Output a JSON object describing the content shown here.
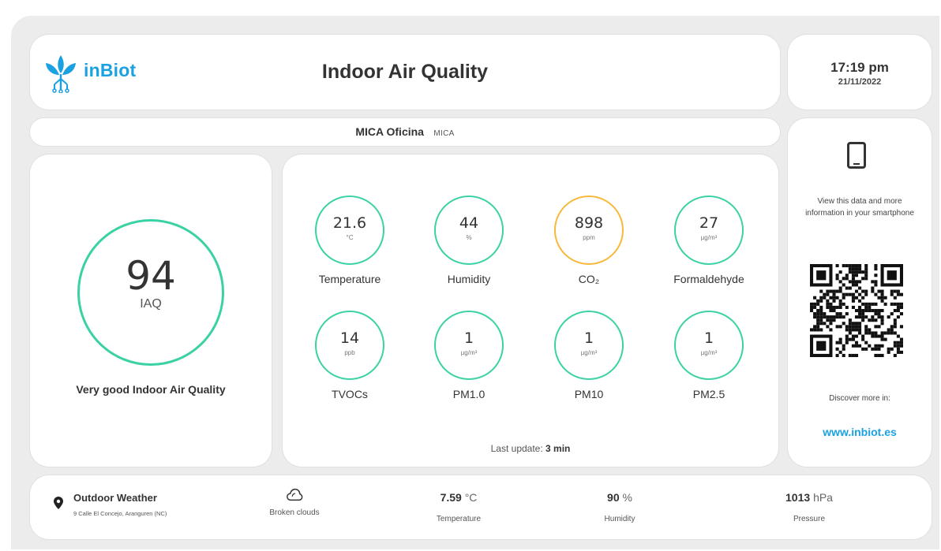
{
  "header": {
    "brand": "inBiot",
    "title": "Indoor Air Quality"
  },
  "clock": {
    "time": "17:19 pm",
    "date": "21/11/2022"
  },
  "location": {
    "name": "MICA Oficina",
    "code": "MICA"
  },
  "iaq": {
    "value": "94",
    "label": "IAQ",
    "status": "Very good Indoor Air Quality",
    "ring_color": "#3ad2a4"
  },
  "metrics": [
    {
      "value": "21.6",
      "unit": "°C",
      "name": "Temperature",
      "state": "good"
    },
    {
      "value": "44",
      "unit": "%",
      "name": "Humidity",
      "state": "good"
    },
    {
      "value": "898",
      "unit": "ppm",
      "name": "CO₂",
      "state": "warning"
    },
    {
      "value": "27",
      "unit": "µg/m³",
      "name": "Formaldehyde",
      "state": "good"
    },
    {
      "value": "14",
      "unit": "ppb",
      "name": "TVOCs",
      "state": "good"
    },
    {
      "value": "1",
      "unit": "µg/m³",
      "name": "PM1.0",
      "state": "good"
    },
    {
      "value": "1",
      "unit": "µg/m³",
      "name": "PM10",
      "state": "good"
    },
    {
      "value": "1",
      "unit": "µg/m³",
      "name": "PM2.5",
      "state": "good"
    }
  ],
  "update": {
    "prefix": "Last update:",
    "value": "3 min"
  },
  "side": {
    "icon": "smartphone-icon",
    "text": "View this data and more information in your smartphone",
    "discover": "Discover more in:",
    "site": "www.inbiot.es"
  },
  "outdoor": {
    "title": "Outdoor Weather",
    "address": "9 Calle El Concejo, Aranguren (NC)",
    "condition": "Broken clouds",
    "temperature": {
      "value": "7.59",
      "unit": "°C",
      "label": "Temperature"
    },
    "humidity": {
      "value": "90",
      "unit": "%",
      "label": "Humidity"
    },
    "pressure": {
      "value": "1013",
      "unit": "hPa",
      "label": "Pressure"
    }
  },
  "colors": {
    "brand": "#1ba1e2",
    "good": "#3ad2a4",
    "warning": "#f6b93b"
  }
}
